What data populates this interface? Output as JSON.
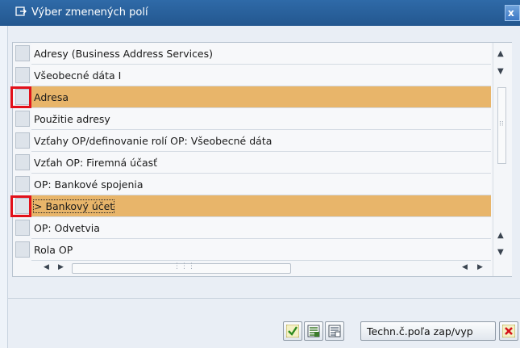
{
  "window": {
    "title": "Výber zmenených polí",
    "close_label": "x"
  },
  "list": {
    "rows": [
      {
        "label": "Adresy (Business Address Services)",
        "highlighted": false,
        "marked": false
      },
      {
        "label": "Všeobecné dáta I",
        "highlighted": false,
        "marked": false
      },
      {
        "label": "Adresa",
        "highlighted": true,
        "marked": true
      },
      {
        "label": "Použitie adresy",
        "highlighted": false,
        "marked": false
      },
      {
        "label": "Vzťahy OP/definovanie rolí OP: Všeobecné dáta",
        "highlighted": false,
        "marked": false
      },
      {
        "label": "Vzťah OP: Firemná účasť",
        "highlighted": false,
        "marked": false
      },
      {
        "label": "OP: Bankové spojenia",
        "highlighted": false,
        "marked": false
      },
      {
        "label": "> Bankový účet",
        "highlighted": true,
        "marked": true
      },
      {
        "label": "OP: Odvetvia",
        "highlighted": false,
        "marked": false
      },
      {
        "label": "Rola OP",
        "highlighted": false,
        "marked": false
      }
    ]
  },
  "toolbar": {
    "techn_label": "Techn.č.poľa zap/vyp"
  },
  "colors": {
    "highlight": "#e8b56a",
    "marker": "#e2111a",
    "title_bar": "#2f6aa8"
  },
  "icons": [
    "dialog-icon",
    "confirm-check-icon",
    "select-all-icon",
    "deselect-all-icon",
    "cancel-icon"
  ]
}
